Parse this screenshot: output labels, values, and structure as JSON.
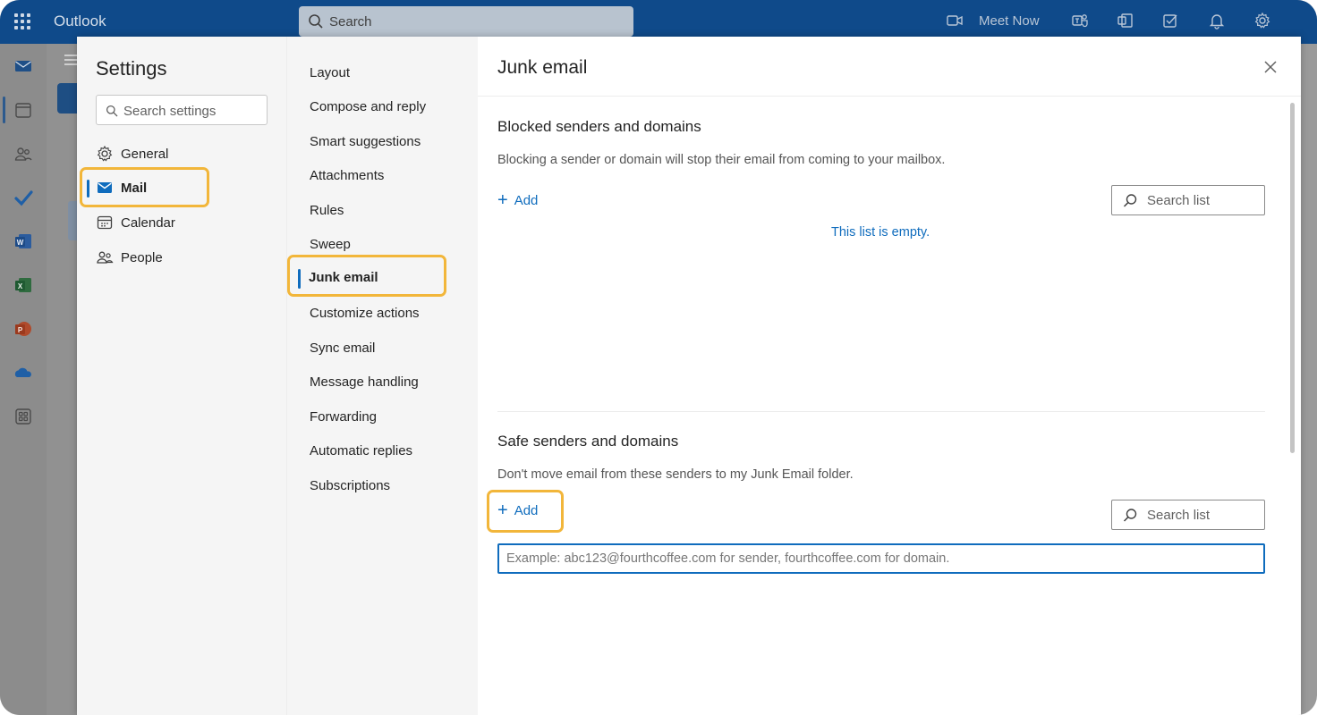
{
  "app": {
    "brand": "Outlook",
    "search_placeholder": "Search",
    "meet_now": "Meet Now"
  },
  "topbar_icons": [
    "apps-waffle-icon",
    "video-camera-icon",
    "teams-icon",
    "office-icon",
    "todo-icon",
    "bell-icon",
    "gear-icon"
  ],
  "rail_icons": [
    "mail-icon",
    "calendar-icon",
    "people-icon",
    "todo-check-icon",
    "word-icon",
    "excel-icon",
    "powerpoint-icon",
    "onedrive-icon",
    "more-apps-icon"
  ],
  "settings": {
    "title": "Settings",
    "search_placeholder": "Search settings",
    "categories": [
      {
        "label": "General",
        "icon": "gear-icon"
      },
      {
        "label": "Mail",
        "icon": "mail-icon",
        "active": true
      },
      {
        "label": "Calendar",
        "icon": "calendar-icon"
      },
      {
        "label": "People",
        "icon": "people-icon"
      }
    ]
  },
  "mail_subnav": [
    "Layout",
    "Compose and reply",
    "Smart suggestions",
    "Attachments",
    "Rules",
    "Sweep",
    "Junk email",
    "Customize actions",
    "Sync email",
    "Message handling",
    "Forwarding",
    "Automatic replies",
    "Subscriptions"
  ],
  "junk": {
    "title": "Junk email",
    "blocked": {
      "title": "Blocked senders and domains",
      "desc": "Blocking a sender or domain will stop their email from coming to your mailbox.",
      "add_label": "Add",
      "search_placeholder": "Search list",
      "empty_text": "This list is empty."
    },
    "safe": {
      "title": "Safe senders and domains",
      "desc": "Don't move email from these senders to my Junk Email folder.",
      "add_label": "Add",
      "search_placeholder": "Search list",
      "input_placeholder": "Example: abc123@fourthcoffee.com for sender, fourthcoffee.com for domain.",
      "input_value": ""
    }
  },
  "colors": {
    "accent": "#0f6cbd",
    "highlight": "#f2b63a",
    "topbar": "#0f4a8a"
  }
}
